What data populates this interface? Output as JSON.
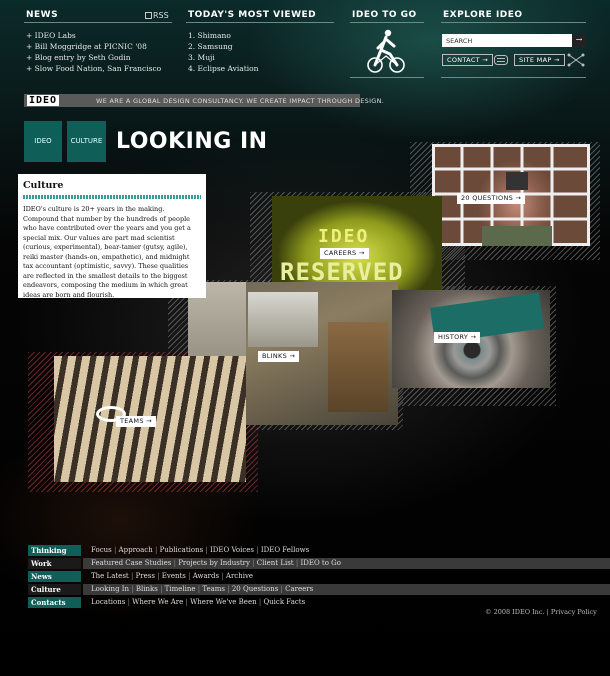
{
  "header": {
    "news": {
      "title": "NEWS",
      "rss": "RSS",
      "items": [
        "+ IDEO Labs",
        "+ Bill Moggridge at PICNIC '08",
        "+ Blog entry by Seth Godin",
        "+ Slow Food Nation, San Francisco"
      ]
    },
    "most_viewed": {
      "title": "TODAY'S MOST VIEWED",
      "items": [
        "1. Shimano",
        "2. Samsung",
        "3. Muji",
        "4. Eclipse Aviation"
      ]
    },
    "ideo_to_go": {
      "title": "IDEO TO GO"
    },
    "explore": {
      "title": "EXPLORE IDEO",
      "search_label": "SEARCH",
      "search_arrow": "→",
      "contact": "CONTACT →",
      "site_map": "SITE MAP →"
    }
  },
  "brand": {
    "logo": "IDEO",
    "tagline": "WE ARE A GLOBAL DESIGN CONSULTANCY.  WE CREATE IMPACT THROUGH DESIGN."
  },
  "breadcrumb": {
    "home": "IDEO",
    "current": "CULTURE"
  },
  "page_title": "LOOKING IN",
  "culture": {
    "heading": "Culture",
    "body": "IDEO's culture is 20+ years in the making. Compound that number by the hundreds of people who have contributed over the years and you get a special mix. Our values are part mad scientist (curious, experimental), bear-tamer (gutsy, agile), reiki master (hands-on, empathetic), and midnight tax accountant (optimistic, savvy). These qualities are reflected in the smallest details to the biggest endeavors, composing the medium in which great ideas are born and flourish."
  },
  "tiles": {
    "questions": "20 QUESTIONS →",
    "careers": "CAREERS →",
    "blinks": "BLINKS →",
    "history": "HISTORY →",
    "teams": "TEAMS →",
    "sign_line1": "IDEO",
    "sign_line2": "RESERVED"
  },
  "footer_nav": [
    {
      "label": "Thinking",
      "active": true,
      "links": [
        "Focus",
        "Approach",
        "Publications",
        "IDEO Voices",
        "IDEO Fellows"
      ]
    },
    {
      "label": "Work",
      "active": false,
      "links": [
        "Featured Case Studies",
        "Projects by Industry",
        "Client List",
        "IDEO to Go"
      ]
    },
    {
      "label": "News",
      "active": true,
      "links": [
        "The Latest",
        "Press",
        "Events",
        "Awards",
        "Archive"
      ]
    },
    {
      "label": "Culture",
      "active": false,
      "links": [
        "Looking In",
        "Blinks",
        "Timeline",
        "Teams",
        "20 Questions",
        "Careers"
      ]
    },
    {
      "label": "Contacts",
      "active": true,
      "links": [
        "Locations",
        "Where We Are",
        "Where We've Been",
        "Quick Facts"
      ]
    }
  ],
  "copyright": "© 2008 IDEO Inc. | Privacy Policy",
  "colors": {
    "teal": "#0f5e58",
    "teal_light": "#3a9b95",
    "gray_bar": "#5a5a5a"
  }
}
